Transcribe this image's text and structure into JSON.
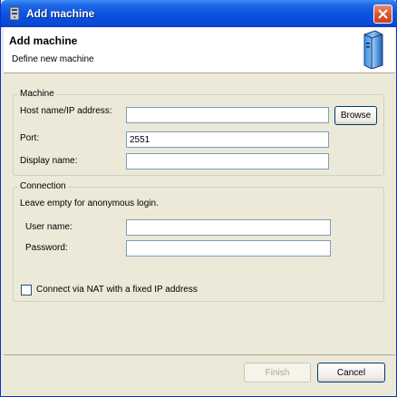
{
  "window": {
    "title": "Add machine"
  },
  "header": {
    "title": "Add machine",
    "subtitle": "Define new machine"
  },
  "machine": {
    "legend": "Machine",
    "host_label": "Host name/IP address:",
    "host_value": "",
    "browse_label": "Browse",
    "port_label": "Port:",
    "port_value": "2551",
    "display_label": "Display name:",
    "display_value": ""
  },
  "connection": {
    "legend": "Connection",
    "hint": "Leave empty for anonymous login.",
    "user_label": "User name:",
    "user_value": "",
    "password_label": "Password:",
    "password_value": "",
    "nat_label": "Connect via NAT with a fixed IP address",
    "nat_checked": false
  },
  "footer": {
    "finish_label": "Finish",
    "finish_enabled": false,
    "cancel_label": "Cancel"
  },
  "icons": {
    "app": "app-icon",
    "close": "close-icon",
    "server": "server-icon"
  }
}
